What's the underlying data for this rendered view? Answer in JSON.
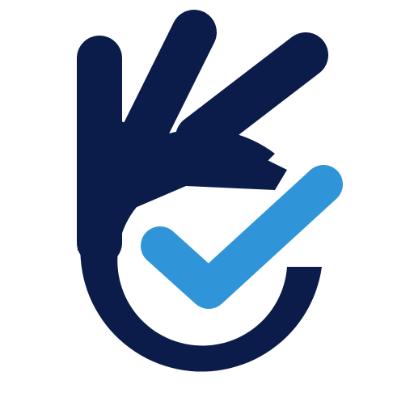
{
  "logo": {
    "icon": "ok-hand-checkmark-icon",
    "colors": {
      "background": "#ffffff",
      "hand": "#0b1c4a",
      "check": "#2f95d8"
    }
  }
}
